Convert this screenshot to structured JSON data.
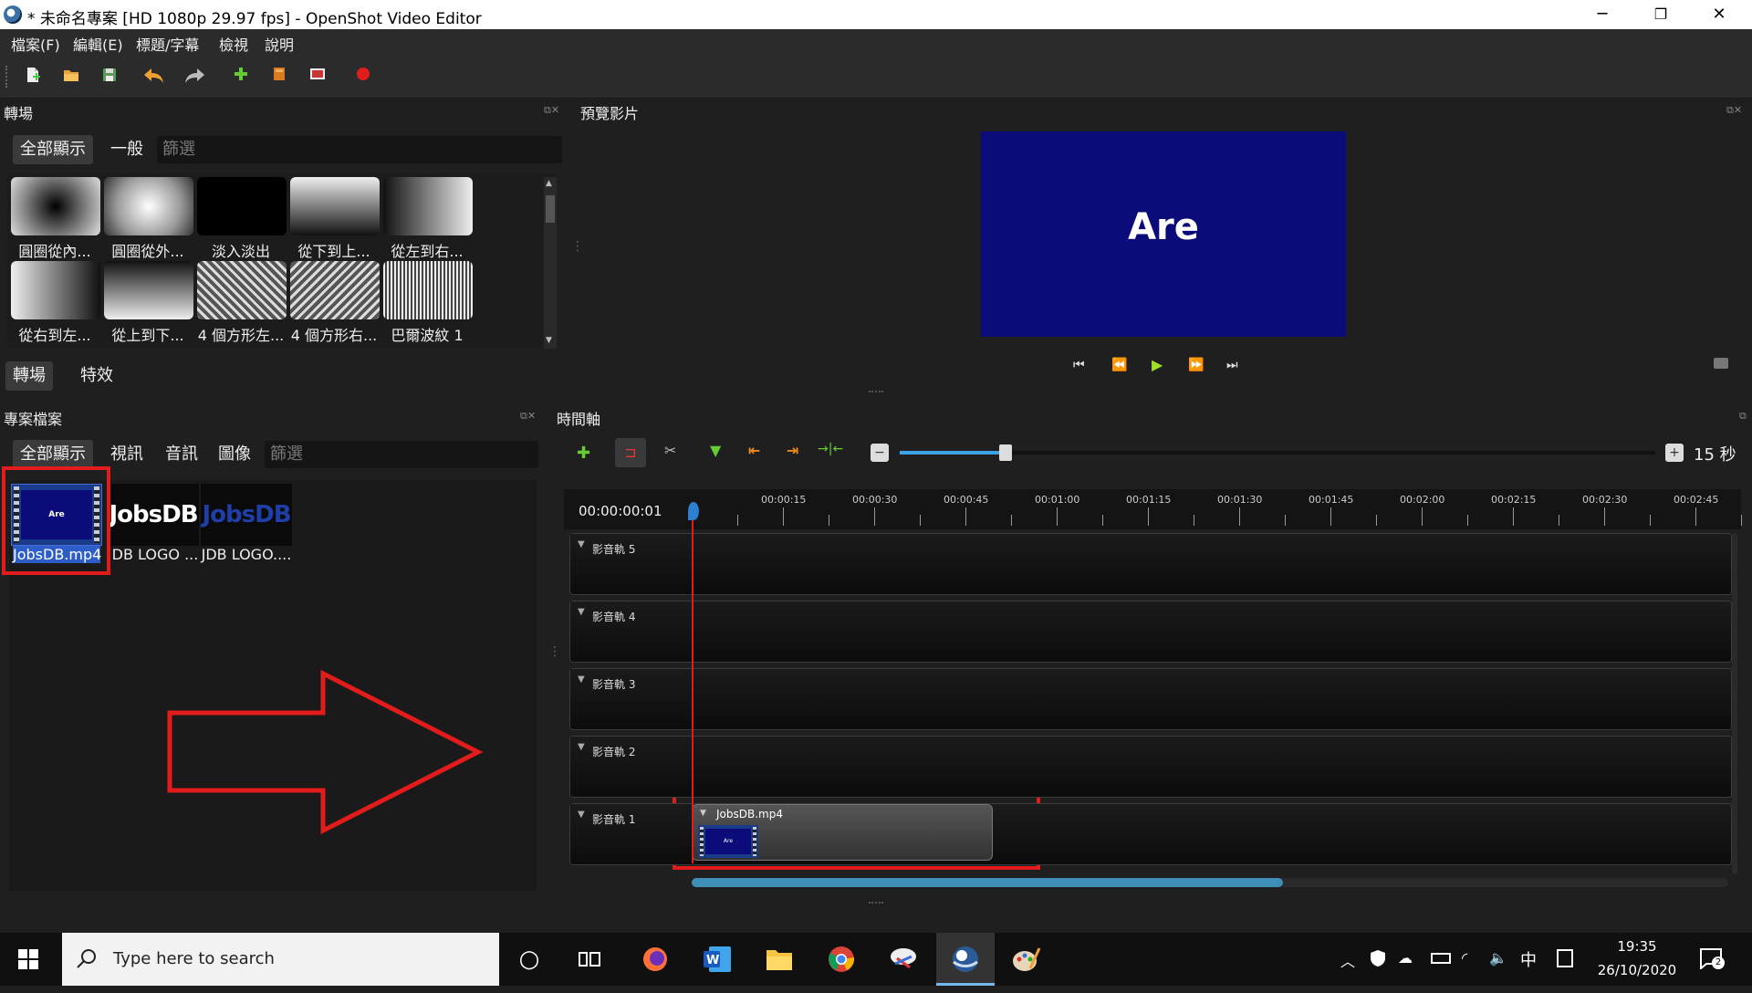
{
  "window": {
    "title": "* 未命名專案 [HD 1080p 29.97 fps] - OpenShot Video Editor",
    "minimize": "─",
    "maximize": "❐",
    "close": "✕"
  },
  "menu": [
    "檔案(F)",
    "編輯(E)",
    "標題/字幕",
    "檢視",
    "說明"
  ],
  "transitions": {
    "title": "轉場",
    "filter_tabs": [
      "全部顯示",
      "一般"
    ],
    "filter_placeholder": "篩選",
    "items": [
      {
        "label": "圓圈從內...",
        "style": "radial-dark"
      },
      {
        "label": "圓圈從外...",
        "style": "radial-light"
      },
      {
        "label": "淡入淡出",
        "style": "black"
      },
      {
        "label": "從下到上...",
        "style": "linear-v"
      },
      {
        "label": "從左到右...",
        "style": "linear-h"
      },
      {
        "label": "從右到左...",
        "style": "linear-h-rev"
      },
      {
        "label": "從上到下...",
        "style": "linear-v-rev"
      },
      {
        "label": "4 個方形左...",
        "style": "stripes"
      },
      {
        "label": "4 個方形右...",
        "style": "stripes-rev"
      },
      {
        "label": "巴爾波紋 1",
        "style": "noise"
      }
    ],
    "bottom_tabs": [
      "轉場",
      "特效"
    ]
  },
  "preview": {
    "title": "預覽影片",
    "frame_text": "Are",
    "frame_color": "#0b0b7a"
  },
  "project_files": {
    "title": "專案檔案",
    "filter_tabs": [
      "全部顯示",
      "視訊",
      "音訊",
      "圖像"
    ],
    "filter_placeholder": "篩選",
    "files": [
      {
        "label": "JobsDB.mp4",
        "thumb_text": "Are",
        "selected": true
      },
      {
        "label": "DB LOGO ...",
        "thumb_text": "JobsDB",
        "selected": false
      },
      {
        "label": "JDB LOGO....",
        "thumb_text": "JobsDB",
        "selected": false
      }
    ]
  },
  "timeline": {
    "title": "時間軸",
    "timecode": "00:00:00:01",
    "zoom_label": "15 秒",
    "zoom_fraction": 0.14,
    "scroll_fraction": 0.57,
    "ruler": [
      "00:00:15",
      "00:00:30",
      "00:00:45",
      "00:01:00",
      "00:01:15",
      "00:01:30",
      "00:01:45",
      "00:02:00",
      "00:02:15",
      "00:02:30",
      "00:02:45"
    ],
    "tracks": [
      "影音軌 5",
      "影音軌 4",
      "影音軌 3",
      "影音軌 2",
      "影音軌 1"
    ],
    "clip": {
      "name": "JobsDB.mp4",
      "thumb_text": "Are"
    }
  },
  "taskbar": {
    "search_placeholder": "Type here to search",
    "time": "19:35",
    "date": "26/10/2020",
    "ime": "中",
    "notification_count": "2",
    "accent": "#0078d7"
  }
}
